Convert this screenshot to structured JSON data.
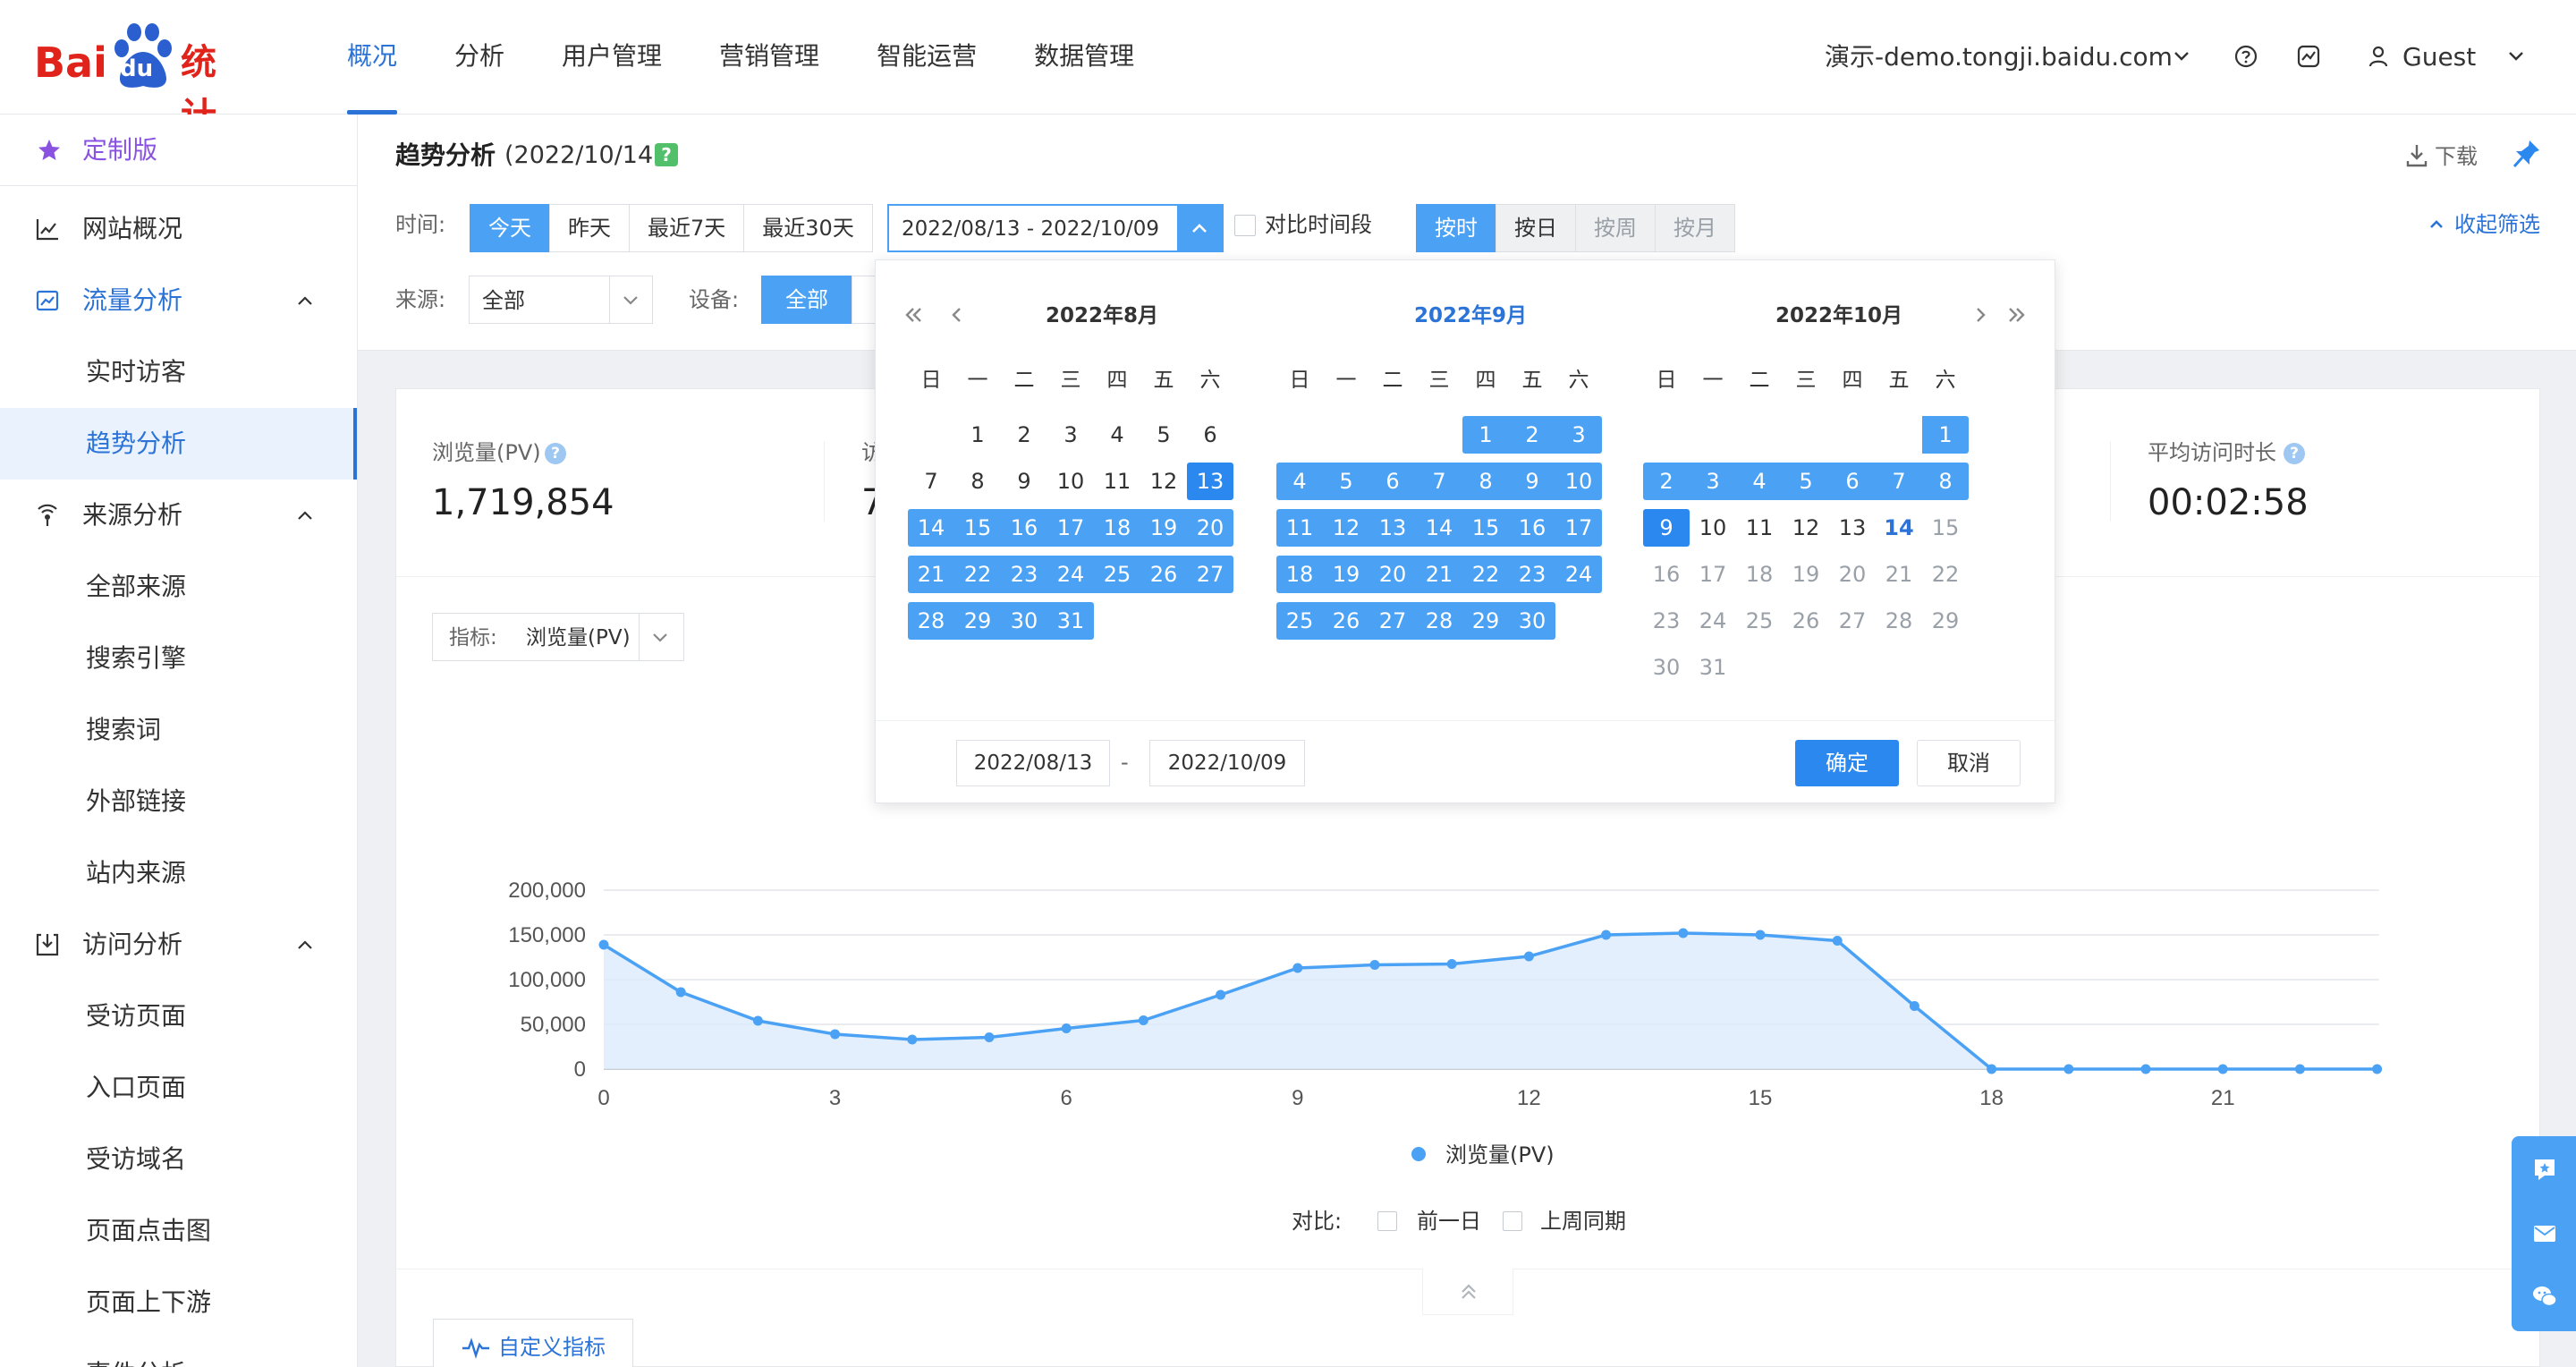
{
  "brand": {
    "logo_text": "Bai",
    "logo_paw": "du",
    "logo_suffix": "统计"
  },
  "nav": {
    "items": [
      {
        "label": "概况",
        "active": true
      },
      {
        "label": "分析",
        "active": false
      },
      {
        "label": "用户管理",
        "active": false
      },
      {
        "label": "营销管理",
        "active": false
      },
      {
        "label": "智能运营",
        "active": false
      },
      {
        "label": "数据管理",
        "active": false
      }
    ]
  },
  "header": {
    "site": "演示-demo.tongji.baidu.com",
    "user": "Guest"
  },
  "sidebar": {
    "custom": "定制版",
    "items": [
      {
        "label": "网站概况"
      },
      {
        "label": "流量分析"
      },
      {
        "label": "实时访客"
      },
      {
        "label": "趋势分析"
      },
      {
        "label": "来源分析"
      },
      {
        "label": "全部来源"
      },
      {
        "label": "搜索引擎"
      },
      {
        "label": "搜索词"
      },
      {
        "label": "外部链接"
      },
      {
        "label": "站内来源"
      },
      {
        "label": "访问分析"
      },
      {
        "label": "受访页面"
      },
      {
        "label": "入口页面"
      },
      {
        "label": "受访域名"
      },
      {
        "label": "页面点击图"
      },
      {
        "label": "页面上下游"
      },
      {
        "label": "事件分析"
      }
    ]
  },
  "panel": {
    "title": "趋势分析",
    "date": "(2022/10/14)",
    "badge": "?",
    "download": "下载",
    "time_label": "时间:",
    "time_buttons": [
      "今天",
      "昨天",
      "最近7天",
      "最近30天"
    ],
    "date_range": "2022/08/13 - 2022/10/09",
    "compare": "对比时间段",
    "granularity": [
      "按时",
      "按日",
      "按周",
      "按月"
    ],
    "collapse": "收起筛选",
    "source_label": "来源:",
    "source_value": "全部",
    "device_label": "设备:",
    "device_value": "全部"
  },
  "metrics": [
    {
      "label": "浏览量(PV)",
      "value": "1,719,854"
    },
    {
      "label": "访",
      "value": "7"
    },
    {
      "label": "平均访问时长",
      "value": "00:02:58"
    }
  ],
  "indicator": {
    "key": "指标:",
    "value": "浏览量(PV)"
  },
  "chart_data": {
    "type": "area",
    "title": "",
    "xlabel": "",
    "ylabel": "",
    "x": [
      0,
      1,
      2,
      3,
      4,
      5,
      6,
      7,
      8,
      9,
      10,
      11,
      12,
      13,
      14,
      15,
      16,
      17,
      18,
      19,
      20,
      21,
      22,
      23
    ],
    "x_ticks": [
      0,
      3,
      6,
      9,
      12,
      15,
      18,
      21
    ],
    "y_ticks": [
      "200,000",
      "150,000",
      "100,000",
      "50,000",
      "0"
    ],
    "ylim": [
      0,
      200000
    ],
    "grid": true,
    "legend": "bottom",
    "series": [
      {
        "name": "浏览量(PV)",
        "color": "#4ba2f5",
        "values": [
          139000,
          86000,
          54000,
          39000,
          33000,
          35500,
          45500,
          54500,
          83000,
          113000,
          116500,
          117500,
          126000,
          150000,
          152000,
          150000,
          143500,
          70500,
          0,
          0,
          0,
          0,
          0,
          0
        ]
      }
    ]
  },
  "legend": {
    "label": "浏览量(PV)"
  },
  "compare": {
    "label": "对比:",
    "options": [
      "前一日",
      "上周同期"
    ]
  },
  "custom_metric": "自定义指标",
  "calendar": {
    "months": [
      {
        "title": "2022年8月",
        "highlight": false
      },
      {
        "title": "2022年9月",
        "highlight": true
      },
      {
        "title": "2022年10月",
        "highlight": false
      }
    ],
    "weekdays": [
      "日",
      "一",
      "二",
      "三",
      "四",
      "五",
      "六"
    ],
    "start_input": "2022/08/13",
    "end_input": "2022/10/09",
    "dash": "-",
    "ok": "确定",
    "cancel": "取消"
  }
}
